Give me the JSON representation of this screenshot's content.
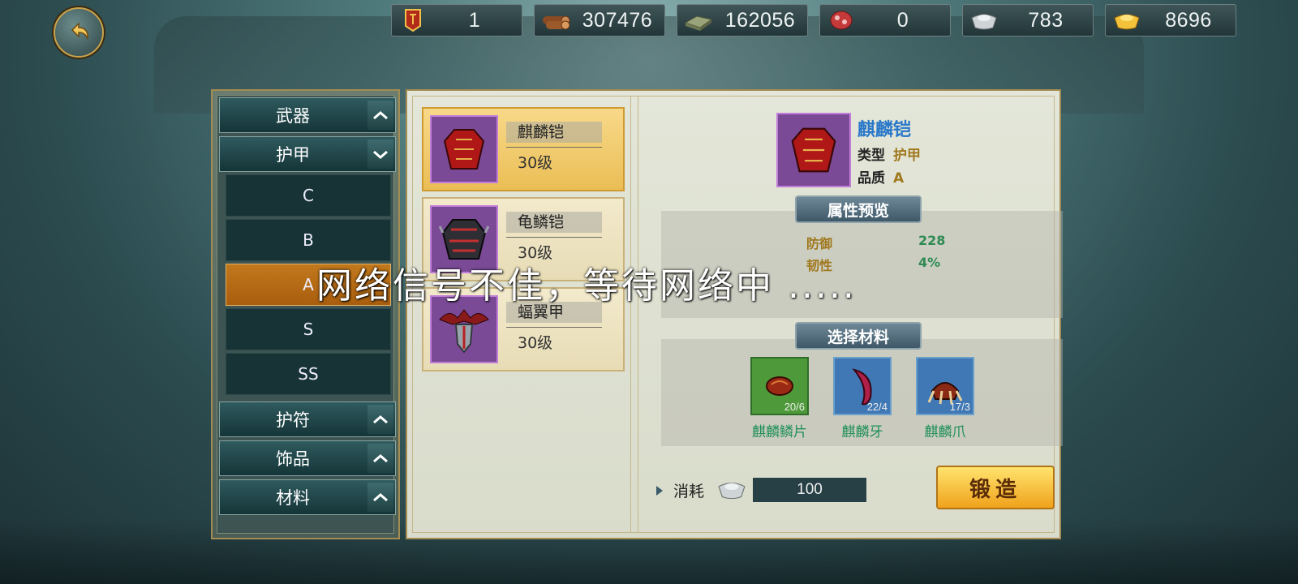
{
  "resources": [
    {
      "icon": "order-token-icon",
      "value": "1"
    },
    {
      "icon": "wood-icon",
      "value": "307476"
    },
    {
      "icon": "stone-icon",
      "value": "162056"
    },
    {
      "icon": "meat-icon",
      "value": "0"
    },
    {
      "icon": "silver-ingot-icon",
      "value": "783"
    },
    {
      "icon": "gold-ingot-icon",
      "value": "8696"
    }
  ],
  "sidebar": {
    "categories": [
      {
        "label": "武器"
      },
      {
        "label": "护甲"
      },
      {
        "label": "护符"
      },
      {
        "label": "饰品"
      },
      {
        "label": "材料"
      }
    ],
    "subitems": [
      "C",
      "B",
      "A",
      "S",
      "SS"
    ],
    "active_sub": "A"
  },
  "items": [
    {
      "name": "麒麟铠",
      "level": "30级",
      "selected": true
    },
    {
      "name": "龟鳞铠",
      "level": "30级",
      "selected": false
    },
    {
      "name": "蝠翼甲",
      "level": "30级",
      "selected": false
    }
  ],
  "detail": {
    "name": "麒麟铠",
    "type_label": "类型",
    "type_value": "护甲",
    "quality_label": "品质",
    "quality_value": "A",
    "attr_title": "属性预览",
    "attrs": [
      {
        "key": "防御",
        "value": "228"
      },
      {
        "key": "韧性",
        "value": "4%"
      }
    ],
    "material_title": "选择材料",
    "materials": [
      {
        "name": "麒麟鳞片",
        "count": "20/6",
        "bg": "#4e9a3a",
        "border": "#2f6e2a"
      },
      {
        "name": "麒麟牙",
        "count": "22/4",
        "bg": "#3f78b4",
        "border": "#6aa0c9"
      },
      {
        "name": "麒麟爪",
        "count": "17/3",
        "bg": "#3f78b4",
        "border": "#6aa0c9"
      }
    ],
    "cost_label": "消耗",
    "cost_value": "100",
    "forge_label": "锻造"
  },
  "toast": "网络信号不佳，等待网络中 ....."
}
